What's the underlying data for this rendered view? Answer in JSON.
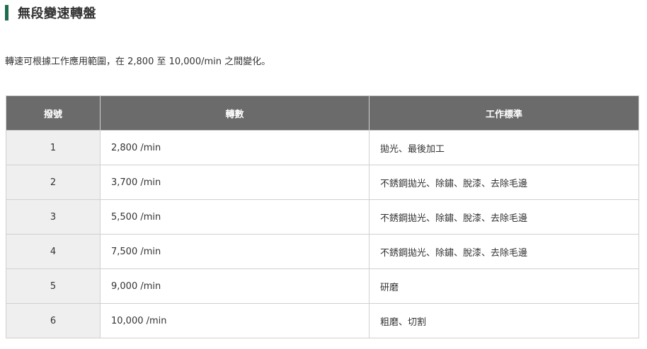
{
  "section": {
    "title": "無段變速轉盤",
    "accent_color": "#1f6b4f",
    "description": "轉速可根據工作應用範圍，在 2,800 至 10,000/min 之間變化。"
  },
  "table": {
    "header_bg": "#6b6b6b",
    "headers": [
      "撥號",
      "轉數",
      "工作標準"
    ],
    "rows": [
      {
        "dial": "1",
        "speed": "2,800 /min",
        "application": "拋光、最後加工"
      },
      {
        "dial": "2",
        "speed": "3,700 /min",
        "application": "不銹鋼拋光、除鏽、脫漆、去除毛邊"
      },
      {
        "dial": "3",
        "speed": "5,500 /min",
        "application": "不銹鋼拋光、除鏽、脫漆、去除毛邊"
      },
      {
        "dial": "4",
        "speed": "7,500 /min",
        "application": "不銹鋼拋光、除鏽、脫漆、去除毛邊"
      },
      {
        "dial": "5",
        "speed": "9,000 /min",
        "application": "研磨"
      },
      {
        "dial": "6",
        "speed": "10,000 /min",
        "application": "粗磨、切割"
      }
    ]
  }
}
